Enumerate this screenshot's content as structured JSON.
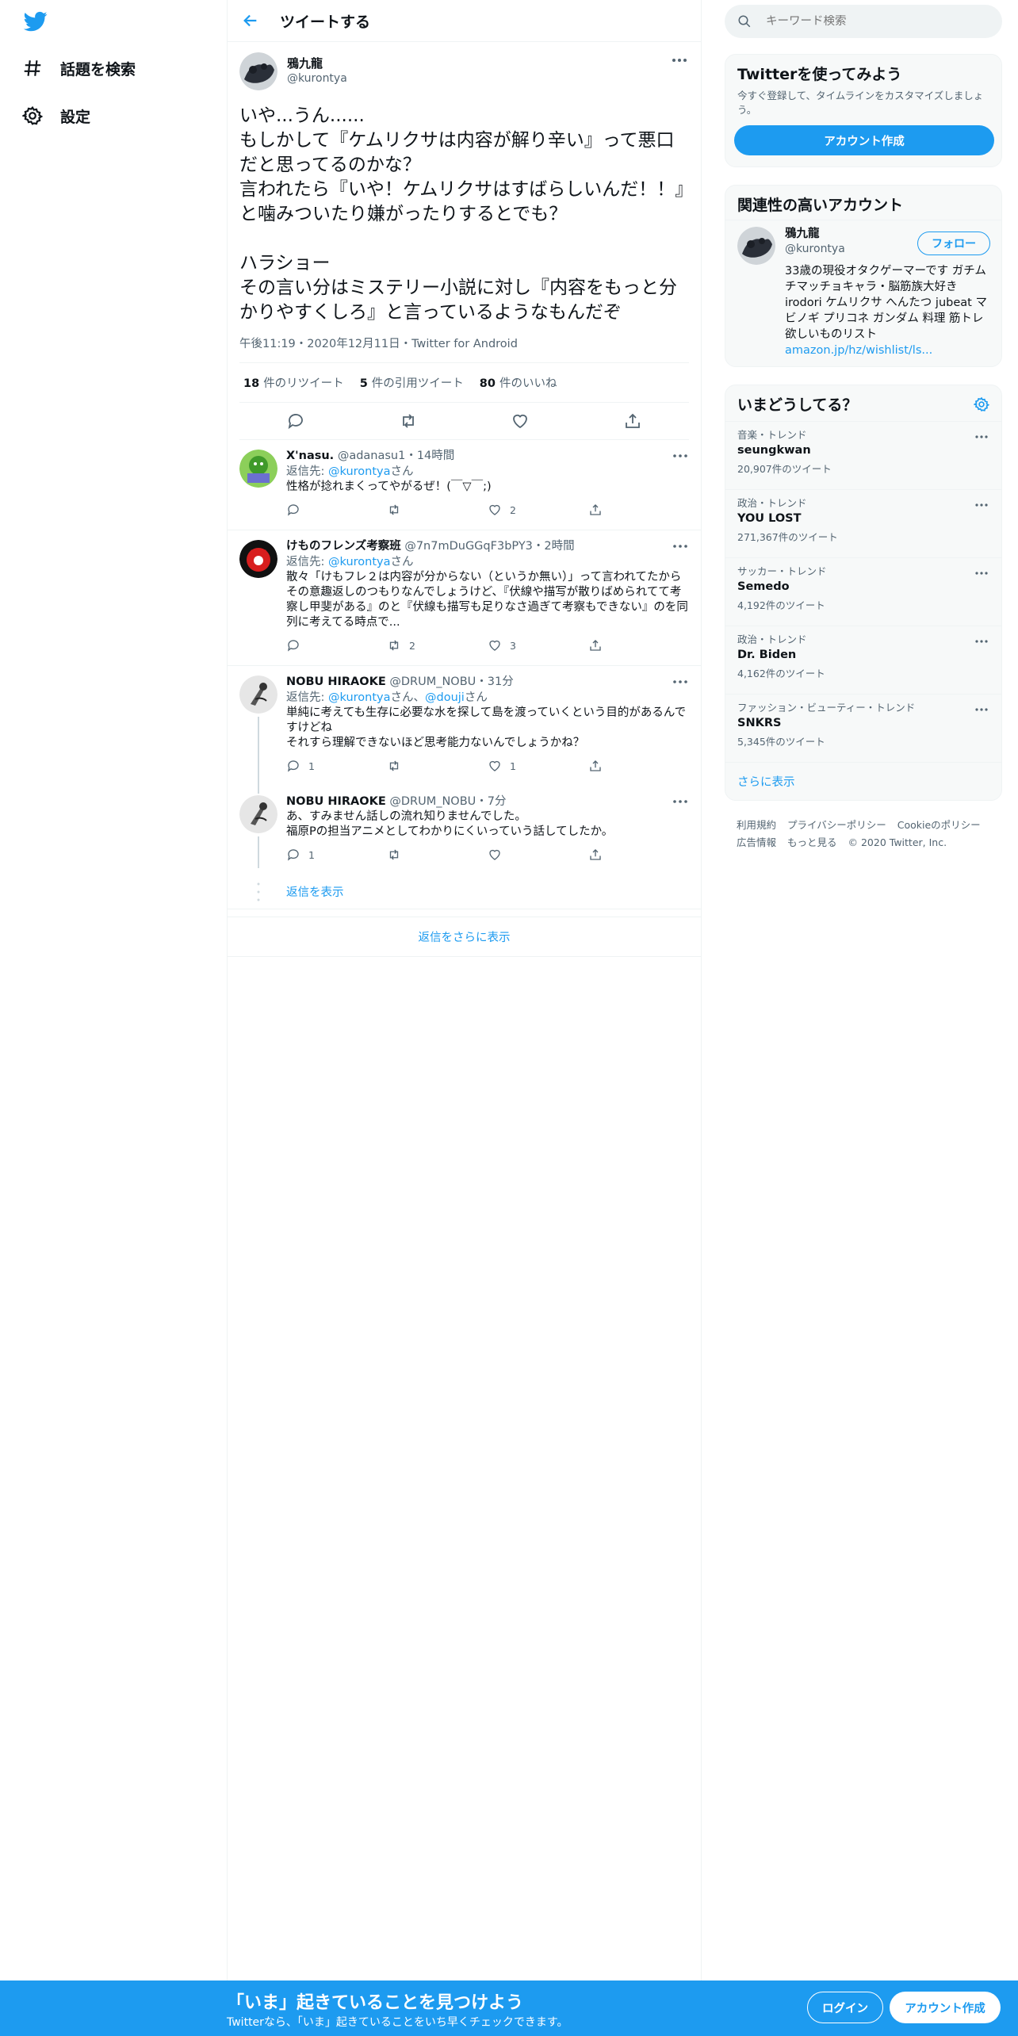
{
  "nav": {
    "explore_label": "話題を検索",
    "settings_label": "設定"
  },
  "header": {
    "title": "ツイートする"
  },
  "focal": {
    "display_name": "鴉九龍",
    "username": "@kurontya",
    "text": "いや...うん......\nもしかして『ケムリクサは内容が解り辛い』って悪口だと思ってるのかな？\n言われたら『いや！ケムリクサはすばらしいんだ！！』と噛みついたり嫌がったりするとでも？\n\nハラショー\nその言い分はミステリー小説に対し『内容をもっと分かりやすくしろ』と言っているようなもんだぞ",
    "meta": "午後11:19・2020年12月11日・Twitter for Android",
    "stats": [
      {
        "count": "18",
        "label": "件のリツイート"
      },
      {
        "count": "5",
        "label": "件の引用ツイート"
      },
      {
        "count": "80",
        "label": "件のいいね"
      }
    ]
  },
  "replies": [
    {
      "name": "X'nasu.",
      "meta": "@adanasu1・14時間",
      "reply_prefix": "返信先: ",
      "reply_to": "@kurontya",
      "reply_to2": "",
      "reply_suffix": "さん",
      "text": "性格が捻れまくってやがるぜ！(￣▽￣;)",
      "reply_count": "",
      "retweet_count": "",
      "like_count": "2"
    },
    {
      "name": "けものフレンズ考察班",
      "meta": "@7n7mDuGGqF3bPY3・2時間",
      "reply_prefix": "返信先: ",
      "reply_to": "@kurontya",
      "reply_to2": "",
      "reply_suffix": "さん",
      "text": "散々「けもフレ２は内容が分からない（というか無い）」って言われてたからその意趣返しのつもりなんでしょうけど、『伏線や描写が散りばめられてて考察し甲斐がある』のと『伏線も描写も足りなさ過ぎて考察もできない』のを同列に考えてる時点で...",
      "reply_count": "",
      "retweet_count": "2",
      "like_count": "3"
    },
    {
      "name": "NOBU HIRAOKE",
      "meta": "@DRUM_NOBU・31分",
      "reply_prefix": "返信先: ",
      "reply_to": "@kurontya",
      "reply_sep": "さん、",
      "reply_to2": "@douji",
      "reply_suffix": "さん",
      "text": "単純に考えても生存に必要な水を探して島を渡っていくという目的があるんですけどね\nそれすら理解できないほど思考能力ないんでしょうかね？",
      "reply_count": "1",
      "retweet_count": "",
      "like_count": "1"
    },
    {
      "name": "NOBU HIRAOKE",
      "meta": "@DRUM_NOBU・7分",
      "text": "あ、すみません話しの流れ知りませんでした。\n福原Pの担当アニメとしてわかりにくいっていう話してしたか。",
      "reply_count": "1",
      "retweet_count": "",
      "like_count": ""
    }
  ],
  "show_replies": "返信を表示",
  "show_more_replies": "返信をさらに表示",
  "search": {
    "placeholder": "キーワード検索"
  },
  "signup_card": {
    "title": "Twitterを使ってみよう",
    "desc": "今すぐ登録して、タイムラインをカスタマイズしましょう。",
    "button": "アカウント作成"
  },
  "related": {
    "title": "関連性の高いアカウント",
    "display_name": "鴉九龍",
    "username": "@kurontya",
    "follow": "フォロー",
    "bio": "33歳の現役オタクゲーマーです ガチムチマッチョキャラ・脳筋族大好き irodori ケムリクサ へんたつ jubeat マビノギ プリコネ ガンダム 料理 筋トレ 欲しいものリスト",
    "link": "amazon.jp/hz/wishlist/ls..."
  },
  "trends": {
    "title": "いまどうしてる？",
    "items": [
      {
        "category": "音楽・トレンド",
        "name": "seungkwan",
        "count": "20,907件のツイート"
      },
      {
        "category": "政治・トレンド",
        "name": "YOU LOST",
        "count": "271,367件のツイート"
      },
      {
        "category": "サッカー・トレンド",
        "name": "Semedo",
        "count": "4,192件のツイート"
      },
      {
        "category": "政治・トレンド",
        "name": "Dr. Biden",
        "count": "4,162件のツイート"
      },
      {
        "category": "ファッション・ビューティー・トレンド",
        "name": "SNKRS",
        "count": "5,345件のツイート"
      }
    ],
    "more": "さらに表示"
  },
  "footer": {
    "terms": "利用規約",
    "privacy": "プライバシーポリシー",
    "cookie": "Cookieのポリシー",
    "ads": "広告情報",
    "more": "もっと見る",
    "copyright": "© 2020 Twitter, Inc."
  },
  "bottom": {
    "title": "「いま」起きていることを見つけよう",
    "sub": "Twitterなら、「いま」起きていることをいち早くチェックできます。",
    "login": "ログイン",
    "signup": "アカウント作成"
  },
  "colors": {
    "accent": "#1d9bf0",
    "text": "#0f1419",
    "muted": "#536471",
    "border": "#eff3f4"
  }
}
